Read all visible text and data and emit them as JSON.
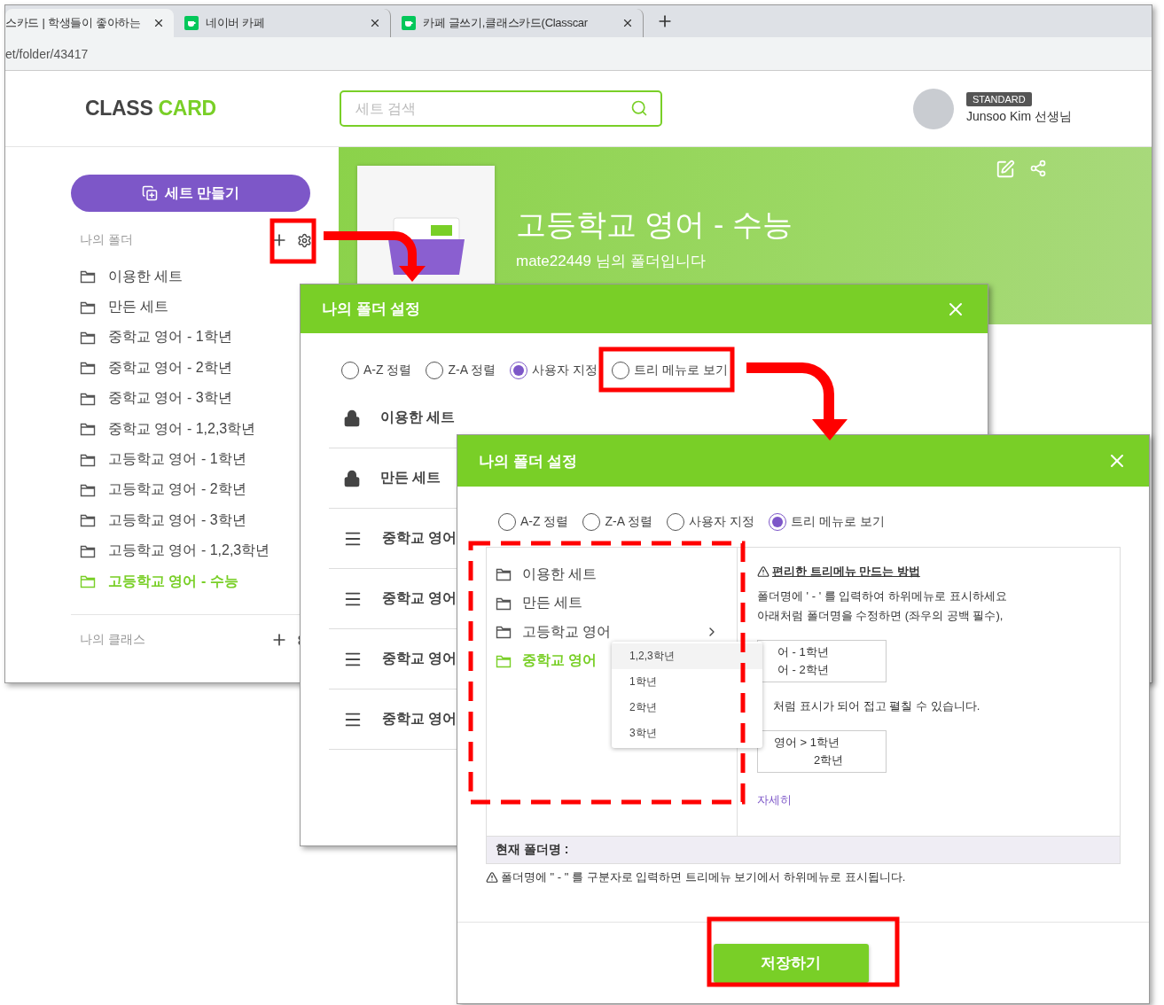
{
  "browser": {
    "tabs": [
      {
        "title": "스카드 | 학생들이 좋아하는",
        "selected": true,
        "kind": "plain"
      },
      {
        "title": "네이버 카페",
        "selected": false,
        "kind": "cafe"
      },
      {
        "title": "카페 글쓰기,클래스카드(Classcar",
        "selected": false,
        "kind": "cafe"
      }
    ],
    "address": "et/folder/43417"
  },
  "header": {
    "logo": {
      "part_1": "CLASS",
      "part_2": "CARD"
    },
    "search": {
      "placeholder": "세트 검색"
    },
    "user": {
      "badge": "STANDARD",
      "name": "Junsoo Kim 선생님"
    }
  },
  "sidebar": {
    "create_button": "세트 만들기",
    "folders_heading": "나의 폴더",
    "folders": [
      {
        "label": "이용한 세트",
        "selected": false
      },
      {
        "label": "만든 세트",
        "selected": false
      },
      {
        "label": "중학교 영어 - 1학년",
        "selected": false
      },
      {
        "label": "중학교 영어 - 2학년",
        "selected": false
      },
      {
        "label": "중학교 영어 - 3학년",
        "selected": false
      },
      {
        "label": "중학교 영어 - 1,2,3학년",
        "selected": false
      },
      {
        "label": "고등학교 영어 - 1학년",
        "selected": false
      },
      {
        "label": "고등학교 영어 - 2학년",
        "selected": false
      },
      {
        "label": "고등학교 영어 - 3학년",
        "selected": false
      },
      {
        "label": "고등학교 영어 - 1,2,3학년",
        "selected": false
      },
      {
        "label": "고등학교 영어 - 수능",
        "selected": true
      }
    ],
    "classes_heading": "나의 클래스"
  },
  "banner": {
    "title": "고등학교 영어 - 수능",
    "subtitle": "mate22449 님의 폴더입니다"
  },
  "dialog_1": {
    "title": "나의 폴더 설정",
    "sort_options": [
      {
        "label": "A-Z 정렬",
        "selected": false
      },
      {
        "label": "Z-A 정렬",
        "selected": false
      },
      {
        "label": "사용자 지정",
        "selected": true
      },
      {
        "label": "트리 메뉴로 보기",
        "selected": false
      }
    ],
    "rows": [
      {
        "kind": "locked",
        "label": "이용한 세트"
      },
      {
        "kind": "locked",
        "label": "만든 세트"
      },
      {
        "kind": "movable",
        "label": "중학교 영어"
      },
      {
        "kind": "movable",
        "label": "중학교 영어"
      },
      {
        "kind": "movable",
        "label": "중학교 영어"
      },
      {
        "kind": "movable",
        "label": "중학교 영어"
      }
    ]
  },
  "dialog_2": {
    "title": "나의 폴더 설정",
    "sort_options": [
      {
        "label": "A-Z 정렬",
        "selected": false
      },
      {
        "label": "Z-A 정렬",
        "selected": false
      },
      {
        "label": "사용자 지정",
        "selected": false
      },
      {
        "label": "트리 메뉴로 보기",
        "selected": true
      }
    ],
    "tree": [
      {
        "label": "이용한 세트",
        "selected": false,
        "expandable": false
      },
      {
        "label": "만든 세트",
        "selected": false,
        "expandable": false
      },
      {
        "label": "고등학교 영어",
        "selected": false,
        "expandable": true
      },
      {
        "label": "중학교 영어",
        "selected": true,
        "expandable": false
      }
    ],
    "submenu": [
      {
        "label": "1,2,3학년",
        "selected": true
      },
      {
        "label": "1학년",
        "selected": false
      },
      {
        "label": "2학년",
        "selected": false
      },
      {
        "label": "3학년",
        "selected": false
      }
    ],
    "help": {
      "title": "편리한 트리메뉴 만드는 방법",
      "lines": [
        "폴더명에 ' - ' 를 입력하여 하위메뉴로 표시하세요",
        "아래처럼 폴더명을 수정하면 (좌우의 공백 필수),"
      ],
      "example_1": [
        "어 - 1학년",
        "어 - 2학년"
      ],
      "note": "처럼 표시가 되어 접고 펼칠 수 있습니다.",
      "example_2": [
        "영어 > 1학년",
        "2학년"
      ],
      "link": "자세히"
    },
    "current_name_label": "현재 폴더명 :",
    "warning": "폴더명에 \" - \" 를 구분자로 입력하면 트리메뉴 보기에서 하위메뉴로 표시됩니다.",
    "save_button": "저장하기"
  }
}
